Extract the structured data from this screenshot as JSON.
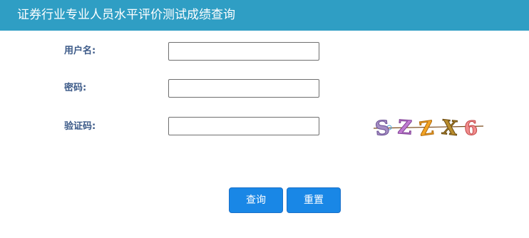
{
  "header": {
    "title": "证券行业专业人员水平评价测试成绩查询"
  },
  "form": {
    "username_label": "用户名:",
    "password_label": "密码:",
    "captcha_label": "验证码:",
    "username_value": "",
    "password_value": "",
    "captcha_value": ""
  },
  "captcha_image": {
    "text": "SZZX6"
  },
  "buttons": {
    "query_label": "查询",
    "reset_label": "重置"
  },
  "colors": {
    "header_bg": "#2f9ec4",
    "label": "#3c5a88",
    "button_bg": "#1987e6"
  }
}
